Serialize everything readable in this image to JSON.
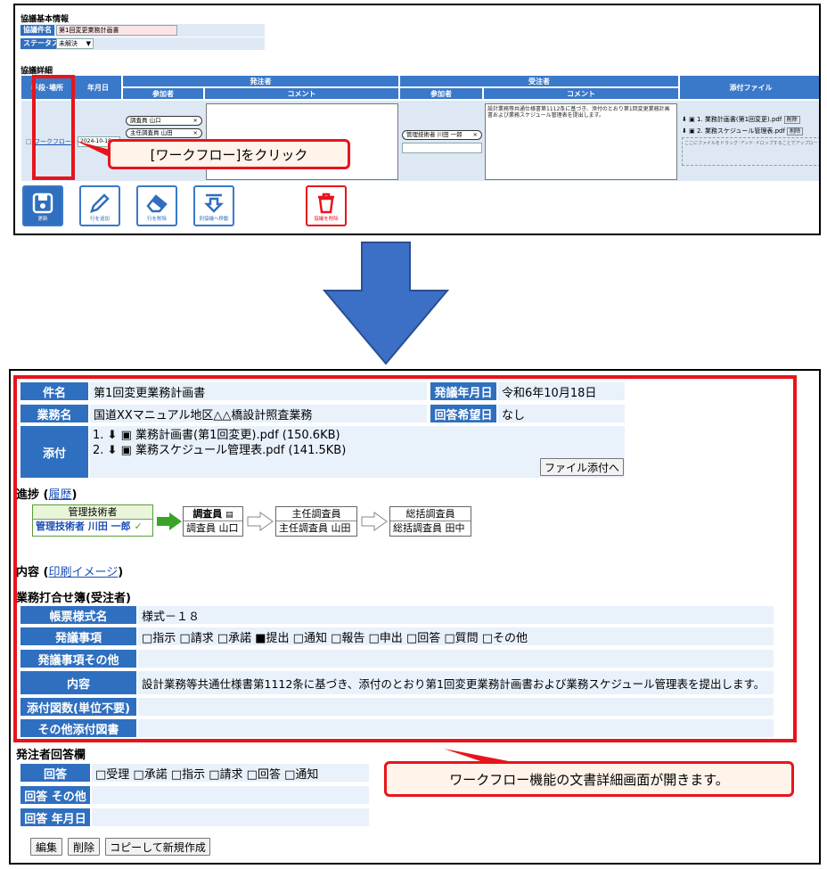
{
  "top": {
    "kyogi_kihon_title": "協議基本情報",
    "kyogi_kenmei_label": "協議件名",
    "kyogi_kenmei_value": "第1回変更業務計画書",
    "status_label": "ステータス",
    "status_value": "未解決",
    "kyogi_shosai_title": "協議詳細",
    "col_shudan": "手段･場所",
    "col_nengappi": "年月日",
    "col_hacchusha": "発注者",
    "col_juchusha": "受注者",
    "col_sanka": "参加者",
    "col_comment": "コメント",
    "col_tenpu": "添付ファイル",
    "workflow_link": "ワークフロー",
    "date_value": "2024-10-18",
    "chips_hacchu": [
      "調査員 山口",
      "主任調査員 山田"
    ],
    "chip_juchu": "管理技術者 川田 一郎",
    "juchu_comment": "設計業務等共通仕様書第1112条に基づき、添付のとおり第1回変更業務計画書および業務スケジュール管理表を提出します。",
    "files": [
      "1. 業務計画書(第1回変更).pdf",
      "2. 業務スケジュール管理表.pdf"
    ],
    "delete_small": "削除",
    "drop_hint": "ここにファイルをドラッグ･アンド･ドロップすることでアップロードできます",
    "buttons": [
      "更新",
      "行を追加",
      "行を削除",
      "別協議へ移動",
      "協議を削除"
    ],
    "callout": "[ワークフロー]をクリック"
  },
  "bottom": {
    "kenmei_label": "件名",
    "kenmei_value": "第1回変更業務計画書",
    "hatsugi_date_label": "発議年月日",
    "hatsugi_date_value": "令和6年10月18日",
    "gyomu_label": "業務名",
    "gyomu_value": "国道XXマニュアル地区△△橋設計照査業務",
    "kaito_kibo_label": "回答希望日",
    "kaito_kibo_value": "なし",
    "tenpu_label": "添付",
    "tenpu_files": [
      "1.",
      "2."
    ],
    "tenpu_names": [
      "業務計画書(第1回変更).pdf (150.6KB)",
      "業務スケジュール管理表.pdf (141.5KB)"
    ],
    "file_attach_button": "ファイル添付へ",
    "progress_label": "進捗",
    "progress_link": "履歴",
    "wf": {
      "s1_head": "管理技術者",
      "s1_body": "管理技術者 川田 一郎",
      "s2_head": "調査員",
      "s2_body": "調査員 山口",
      "s3_head": "主任調査員",
      "s3_body": "主任調査員 山田",
      "s4_head": "総括調査員",
      "s4_body": "総括調査員 田中"
    },
    "naiyo_label": "内容",
    "print_link": "印刷イメージ",
    "sheet_title": "業務打合せ簿(受注者)",
    "rows": [
      {
        "label": "帳票様式名",
        "value": "様式－１８"
      },
      {
        "label": "発議事項",
        "value": "□指示 □請求 □承諾 ■提出 □通知 □報告 □申出 □回答 □質問 □その他"
      },
      {
        "label": "発議事項その他",
        "value": ""
      },
      {
        "label": "内容",
        "value": "設計業務等共通仕様書第1112条に基づき、添付のとおり第1回変更業務計画書および業務スケジュール管理表を提出します。"
      },
      {
        "label": "添付図数(単位不要)",
        "value": ""
      },
      {
        "label": "その他添付図書",
        "value": ""
      }
    ],
    "reply_title": "発注者回答欄",
    "reply_rows": [
      {
        "label": "回答",
        "value": "□受理 □承諾 □指示 □請求 □回答 □通知"
      },
      {
        "label": "回答 その他",
        "value": ""
      },
      {
        "label": "回答 年月日",
        "value": ""
      }
    ],
    "callout": "ワークフロー機能の文書詳細画面が開きます。",
    "btn_edit": "編集",
    "btn_delete": "削除",
    "btn_copy": "コピーして新規作成"
  },
  "colors": {
    "accent": "#2f6fbf",
    "highlight": "#e8141c",
    "arrow": "#3c6fc6"
  }
}
